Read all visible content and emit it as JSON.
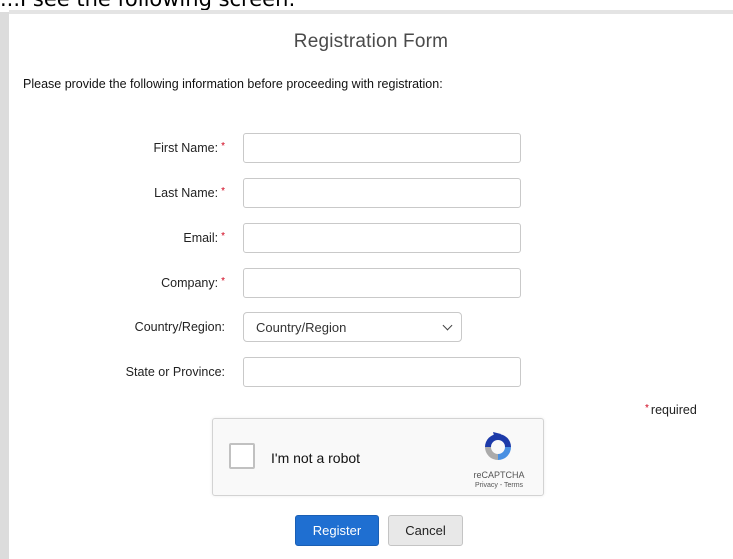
{
  "caption_text": "...I see the following screen:",
  "form": {
    "title": "Registration Form",
    "intro": "Please provide the following information before proceeding with registration:",
    "fields": {
      "first_name": {
        "label": "First Name:",
        "required": "*",
        "value": ""
      },
      "last_name": {
        "label": "Last Name:",
        "required": "*",
        "value": ""
      },
      "email": {
        "label": "Email:",
        "required": "*",
        "value": ""
      },
      "company": {
        "label": "Company:",
        "required": "*",
        "value": ""
      },
      "country": {
        "label": "Country/Region:",
        "selected": "Country/Region"
      },
      "state": {
        "label": "State or Province:",
        "value": ""
      }
    },
    "required_note": {
      "mark": "*",
      "text": "required"
    },
    "captcha": {
      "label": "I'm not a robot",
      "brand": "reCAPTCHA",
      "links": "Privacy - Terms",
      "checked": false,
      "icon": "recaptcha-logo-icon"
    },
    "buttons": {
      "register": "Register",
      "cancel": "Cancel"
    },
    "colors": {
      "primary": "#1f6fd1",
      "required": "#d0021b"
    }
  }
}
